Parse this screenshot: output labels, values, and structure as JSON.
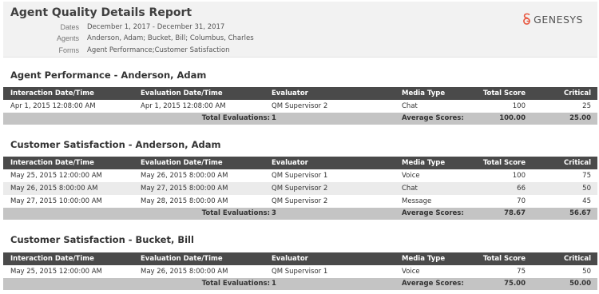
{
  "report": {
    "title": "Agent Quality Details Report",
    "dates_label": "Dates",
    "dates_value": "December 1, 2017 - December 31, 2017",
    "agents_label": "Agents",
    "agents_value": "Anderson, Adam; Bucket, Bill; Columbus, Charles",
    "forms_label": "Forms",
    "forms_value": "Agent Performance;Customer Satisfaction",
    "logo_text": "GENESYS",
    "logo_color": "#e8573f"
  },
  "columns": {
    "interaction": "Interaction Date/Time",
    "evaluation": "Evaluation Date/Time",
    "evaluator": "Evaluator",
    "media": "Media Type",
    "score": "Total Score",
    "critical": "Critical"
  },
  "footer_labels": {
    "total_evaluations": "Total Evaluations:",
    "average_scores": "Average Scores:"
  },
  "sections": [
    {
      "title": "Agent Performance - Anderson, Adam",
      "rows": [
        {
          "interaction": "Apr 1, 2015 12:08:00 AM",
          "evaluation": "Apr 1, 2015 12:08:00 AM",
          "evaluator": "QM Supervisor 2",
          "media": "Chat",
          "score": "100",
          "critical": "25"
        }
      ],
      "total_evaluations": "1",
      "avg_score": "100.00",
      "avg_critical": "25.00"
    },
    {
      "title": "Customer Satisfaction - Anderson, Adam",
      "rows": [
        {
          "interaction": "May 25, 2015 12:00:00 AM",
          "evaluation": "May 26, 2015 8:00:00 AM",
          "evaluator": "QM Supervisor 1",
          "media": "Voice",
          "score": "100",
          "critical": "75"
        },
        {
          "interaction": "May 26, 2015 8:00:00 AM",
          "evaluation": "May 27, 2015 8:00:00 AM",
          "evaluator": "QM Supervisor 2",
          "media": "Chat",
          "score": "66",
          "critical": "50"
        },
        {
          "interaction": "May 27, 2015 10:00:00 AM",
          "evaluation": "May 28, 2015 8:00:00 AM",
          "evaluator": "QM Supervisor 2",
          "media": "Message",
          "score": "70",
          "critical": "45"
        }
      ],
      "total_evaluations": "3",
      "avg_score": "78.67",
      "avg_critical": "56.67"
    },
    {
      "title": "Customer Satisfaction - Bucket, Bill",
      "rows": [
        {
          "interaction": "May 25, 2015 12:00:00 AM",
          "evaluation": "May 26, 2015 8:00:00 AM",
          "evaluator": "QM Supervisor 1",
          "media": "Voice",
          "score": "75",
          "critical": "50"
        }
      ],
      "total_evaluations": "1",
      "avg_score": "75.00",
      "avg_critical": "50.00"
    }
  ]
}
